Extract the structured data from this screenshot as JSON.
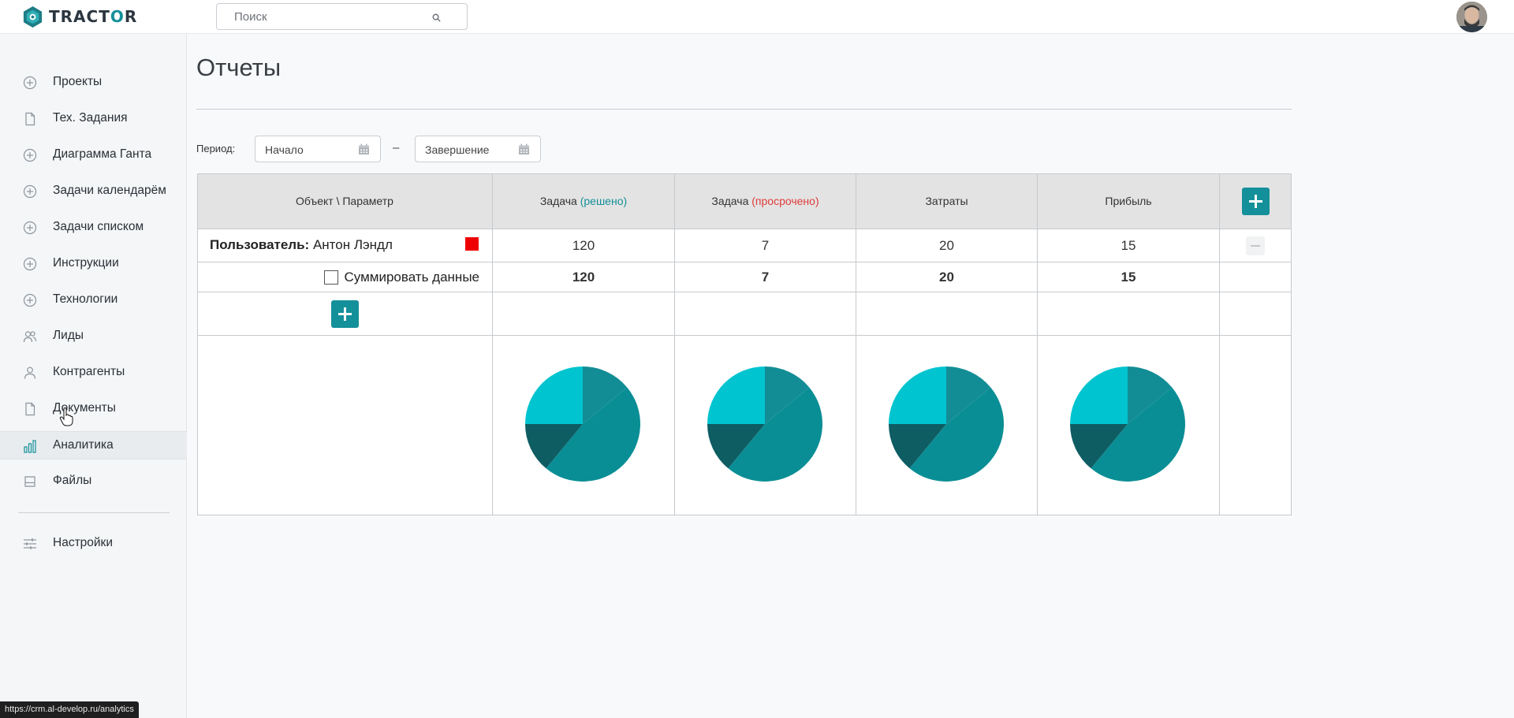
{
  "app": {
    "logo_text_1": "TRACT",
    "logo_text_2": "O",
    "logo_text_3": "R"
  },
  "search": {
    "placeholder": "Поиск"
  },
  "sidebar": {
    "items": [
      {
        "label": "Проекты",
        "icon": "plus-circle-icon"
      },
      {
        "label": "Тех. Задания",
        "icon": "document-icon"
      },
      {
        "label": "Диаграмма Ганта",
        "icon": "plus-circle-icon"
      },
      {
        "label": "Задачи календарём",
        "icon": "plus-circle-icon"
      },
      {
        "label": "Задачи списком",
        "icon": "plus-circle-icon"
      },
      {
        "label": "Инструкции",
        "icon": "plus-circle-icon"
      },
      {
        "label": "Технологии",
        "icon": "plus-circle-icon"
      },
      {
        "label": "Лиды",
        "icon": "users-icon"
      },
      {
        "label": "Контрагенты",
        "icon": "user-icon"
      },
      {
        "label": "Документы",
        "icon": "document-icon"
      },
      {
        "label": "Аналитика",
        "icon": "bar-chart-icon",
        "active": true
      },
      {
        "label": "Файлы",
        "icon": "drive-icon"
      }
    ],
    "settings_label": "Настройки"
  },
  "page": {
    "title": "Отчеты"
  },
  "filters": {
    "period_label": "Период:",
    "start_placeholder": "Начало",
    "end_placeholder": "Завершение",
    "separator": "–"
  },
  "table": {
    "header": {
      "object_param": "Объект \\ Параметр",
      "col1_main": "Задача",
      "col1_status": "(решено)",
      "col2_main": "Задача",
      "col2_status": "(просрочено)",
      "col3": "Затраты",
      "col4": "Прибыль"
    },
    "user_row": {
      "prefix": "Пользователь:",
      "name": "Антон Лэндл",
      "swatch_color": "#ee0000",
      "values": [
        "120",
        "7",
        "20",
        "15"
      ]
    },
    "sum_row": {
      "label": "Суммировать данные",
      "checked": false,
      "values": [
        "120",
        "7",
        "20",
        "15"
      ]
    }
  },
  "colors": {
    "accent": "#14909a",
    "solved": "#14909a",
    "overdue": "#e03b3b",
    "pie_slices": [
      "#138d95",
      "#0a8e95",
      "#0d5d63",
      "#00c4cf"
    ]
  },
  "chart_data": [
    {
      "type": "pie",
      "values": [
        14,
        47,
        14,
        25
      ]
    },
    {
      "type": "pie",
      "values": [
        14,
        47,
        14,
        25
      ]
    },
    {
      "type": "pie",
      "values": [
        14,
        47,
        14,
        25
      ]
    },
    {
      "type": "pie",
      "values": [
        14,
        47,
        14,
        25
      ]
    }
  ],
  "statusbar": {
    "url": "https://crm.al-develop.ru/analytics"
  }
}
